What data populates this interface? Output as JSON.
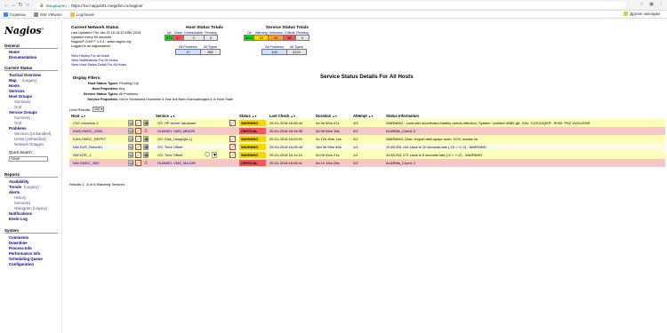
{
  "browser": {
    "secure_label": "Защищено",
    "url": "https://nw-nagios01.megafon.ru/nagios/",
    "bookmarks": [
      "Сервисы",
      "NW VMware",
      "LogViewer"
    ],
    "other_bookmarks": "Другие закладки"
  },
  "nav": {
    "logo": "Nagios",
    "logo_mark": "®",
    "sections": {
      "general": "General",
      "current_status": "Current Status",
      "reports": "Reports",
      "system": "System"
    },
    "general_items": [
      "Home",
      "Documentation"
    ],
    "current_items": {
      "tactical": "Tactical Overview",
      "map": "Map",
      "map_legacy": "(Legacy)",
      "hosts": "Hosts",
      "services": "Services",
      "host_groups": "Host Groups",
      "hg_summary": "Summary",
      "hg_grid": "Grid",
      "service_groups": "Service Groups",
      "sg_summary": "Summary",
      "sg_grid": "Grid",
      "problems": "Problems",
      "p_services": "Services (Unhandled)",
      "p_hosts": "Hosts (Unhandled)",
      "p_outages": "Network Outages"
    },
    "quick_search_label": "Quick Search:",
    "quick_search_value": "*DN5*",
    "reports_items": {
      "availability": "Availability",
      "trends": "Trends",
      "trends_legacy": "(Legacy)",
      "alerts": "Alerts",
      "history": "History",
      "summary": "Summary",
      "histogram": "Histogram (Legacy)",
      "notifications": "Notifications",
      "event_log": "Event Log"
    },
    "system_items": [
      "Comments",
      "Downtime",
      "Process Info",
      "Performance Info",
      "Scheduling Queue",
      "Configuration"
    ]
  },
  "info": {
    "title": "Current Network Status",
    "updated": "Last Updated: Thu Jan 25 16:15:32 MSK 2018",
    "interval": "Updated every 60 seconds",
    "version": "Nagios® Core™ 4.3.4 - www.nagios.org",
    "logged": "Logged in as nagiosadmin",
    "links": [
      "View History For all hosts",
      "View Notifications For All Hosts",
      "View Host Status Detail For All Hosts"
    ]
  },
  "host_totals": {
    "title": "Host Status Totals",
    "headers": [
      "Up",
      "Down",
      "Unreachable",
      "Pending"
    ],
    "values": [
      "573",
      "17",
      "0",
      "0"
    ],
    "all_headers": [
      "All Problems",
      "All Types"
    ],
    "all_values": [
      "17",
      "590"
    ]
  },
  "service_totals": {
    "title": "Service Status Totals",
    "headers": [
      "Ok",
      "Warning",
      "Unknown",
      "Critical",
      "Pending"
    ],
    "values": [
      "8031",
      "19",
      "24",
      "66",
      "0"
    ],
    "all_headers": [
      "All Problems",
      "All Types"
    ],
    "all_values": [
      "109",
      "8120"
    ]
  },
  "filters": {
    "title": "Display Filters:",
    "rows": [
      {
        "label": "Host Status Types:",
        "value": "Pending | Up"
      },
      {
        "label": "Host Properties:",
        "value": "Any"
      },
      {
        "label": "Service Status Types:",
        "value": "All Problems"
      },
      {
        "label": "Service Properties:",
        "value": "Not In Scheduled Downtime & Has Not Been Acknowledged & In Hard State"
      }
    ]
  },
  "page_title": "Service Status Details For All Hosts",
  "limit": {
    "label": "Limit Results:",
    "value": "100"
  },
  "table": {
    "headers": {
      "host": "Host",
      "service": "Service",
      "status": "Status",
      "last_check": "Last Check",
      "duration": "Duration",
      "attempt": "Attempt",
      "info": "Status Information"
    },
    "rows": [
      {
        "host": "CN7-mrradius-1",
        "service": "OS: HP server hardware",
        "status": "WARNING",
        "last_check": "25-01-2018 16:06:44",
        "duration": "0d 3h 50m 47s",
        "attempt": "3/3",
        "info": "WARNING - controller accelerator battery needs attention, System: 'proliant dl380 g6', S/N: 'CZ2016QKR', ROM: 'P62 10/01/2009'"
      },
      {
        "host": "KW6-SMSC_U300",
        "service": "HUAWEI: VMS_MINOR",
        "status": "CRITICAL",
        "last_check": "25-01-2018 16:14:39",
        "duration": "2d 9h 54m 19s",
        "attempt": "2/2",
        "info": "ALARMs_Count: 2"
      },
      {
        "host": "KW6-SMSC_REPRT",
        "service": "OS: Disk_Usage[ALL]",
        "status": "WARNING",
        "last_check": "25-01-2018 16:09:01",
        "duration": "0d 12h 40m 14s",
        "attempt": "2/2",
        "info": "WARNING: Disk: /export disk space warn: 91%, inodes ok"
      },
      {
        "host": "NW-DLR_Roberti1",
        "service": "OS: Time Offset",
        "status": "WARNING",
        "last_check": "25-01-2018 16:05:44",
        "duration": "15d 3h 59m 40s",
        "attempt": "1/1",
        "info": "10.83.251.144 clock is 10 seconds late (-10 > +/-2) - WARNING"
      },
      {
        "host": "NW-NTE_1",
        "service": "OS: Time Offset",
        "status": "WARNING",
        "last_check": "25-01-2018 16:11:10",
        "duration": "0d 0h 54m 21s",
        "attempt": "1/1",
        "info": "10.83.251.171 clock is 6 seconds late (-6 > +/-2) - WARNING"
      },
      {
        "host": "NW-SMSC_I300",
        "service": "HUAWEI: VMS_MAJOR",
        "status": "CRITICAL",
        "last_check": "25-01-2018 16:06:41",
        "duration": "0d 1h 18m 28s",
        "attempt": "2/2",
        "info": "ALARMs_Count: 1"
      }
    ]
  },
  "results": "Results 1 - 6 of 6 Matching Services",
  "colors": {
    "warning": "#fbd500",
    "critical": "#f25858",
    "ok": "#2ed42e",
    "link": "#00008b"
  }
}
